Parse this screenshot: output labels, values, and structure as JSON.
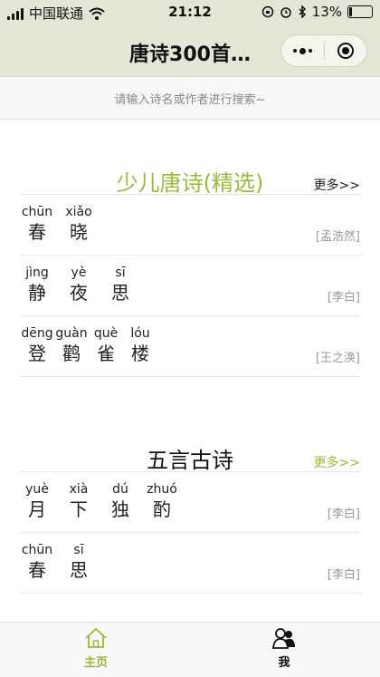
{
  "status_bar": {
    "carrier": "中国联通",
    "time": "21:12",
    "battery_pct": "13%",
    "battery_level": 0.13
  },
  "nav": {
    "title": "唐诗300首…"
  },
  "search": {
    "placeholder": "请输入诗名或作者进行搜索~"
  },
  "sections": [
    {
      "title": "少儿唐诗(精选)",
      "more": "更多>>",
      "poems": [
        {
          "chars": [
            {
              "py": "chūn",
              "hz": "春"
            },
            {
              "py": "xiǎo",
              "hz": "晓"
            }
          ],
          "author": "[孟浩然]"
        },
        {
          "chars": [
            {
              "py": "jìng",
              "hz": "静"
            },
            {
              "py": "yè",
              "hz": "夜"
            },
            {
              "py": "sī",
              "hz": "思"
            }
          ],
          "author": "[李白]"
        },
        {
          "chars": [
            {
              "py": "dēng",
              "hz": "登"
            },
            {
              "py": "guàn",
              "hz": "鹳"
            },
            {
              "py": "què",
              "hz": "雀"
            },
            {
              "py": "lóu",
              "hz": "楼"
            }
          ],
          "author": "[王之涣]"
        }
      ]
    },
    {
      "title": "五言古诗",
      "more": "更多>>",
      "poems": [
        {
          "chars": [
            {
              "py": "yuè",
              "hz": "月"
            },
            {
              "py": "xià",
              "hz": "下"
            },
            {
              "py": "dú",
              "hz": "独"
            },
            {
              "py": "zhuó",
              "hz": "酌"
            }
          ],
          "author": "[李白]"
        },
        {
          "chars": [
            {
              "py": "chūn",
              "hz": "春"
            },
            {
              "py": "sī",
              "hz": "思"
            }
          ],
          "author": "[李白]"
        }
      ]
    }
  ],
  "tabs": [
    {
      "label": "主页",
      "icon": "home-icon",
      "active": true
    },
    {
      "label": "我",
      "icon": "user-icon",
      "active": false
    }
  ],
  "colors": {
    "accent": "#9aba3c",
    "header_bg": "#e5e5d5",
    "author_gray": "#999999",
    "search_text": "#888888"
  }
}
